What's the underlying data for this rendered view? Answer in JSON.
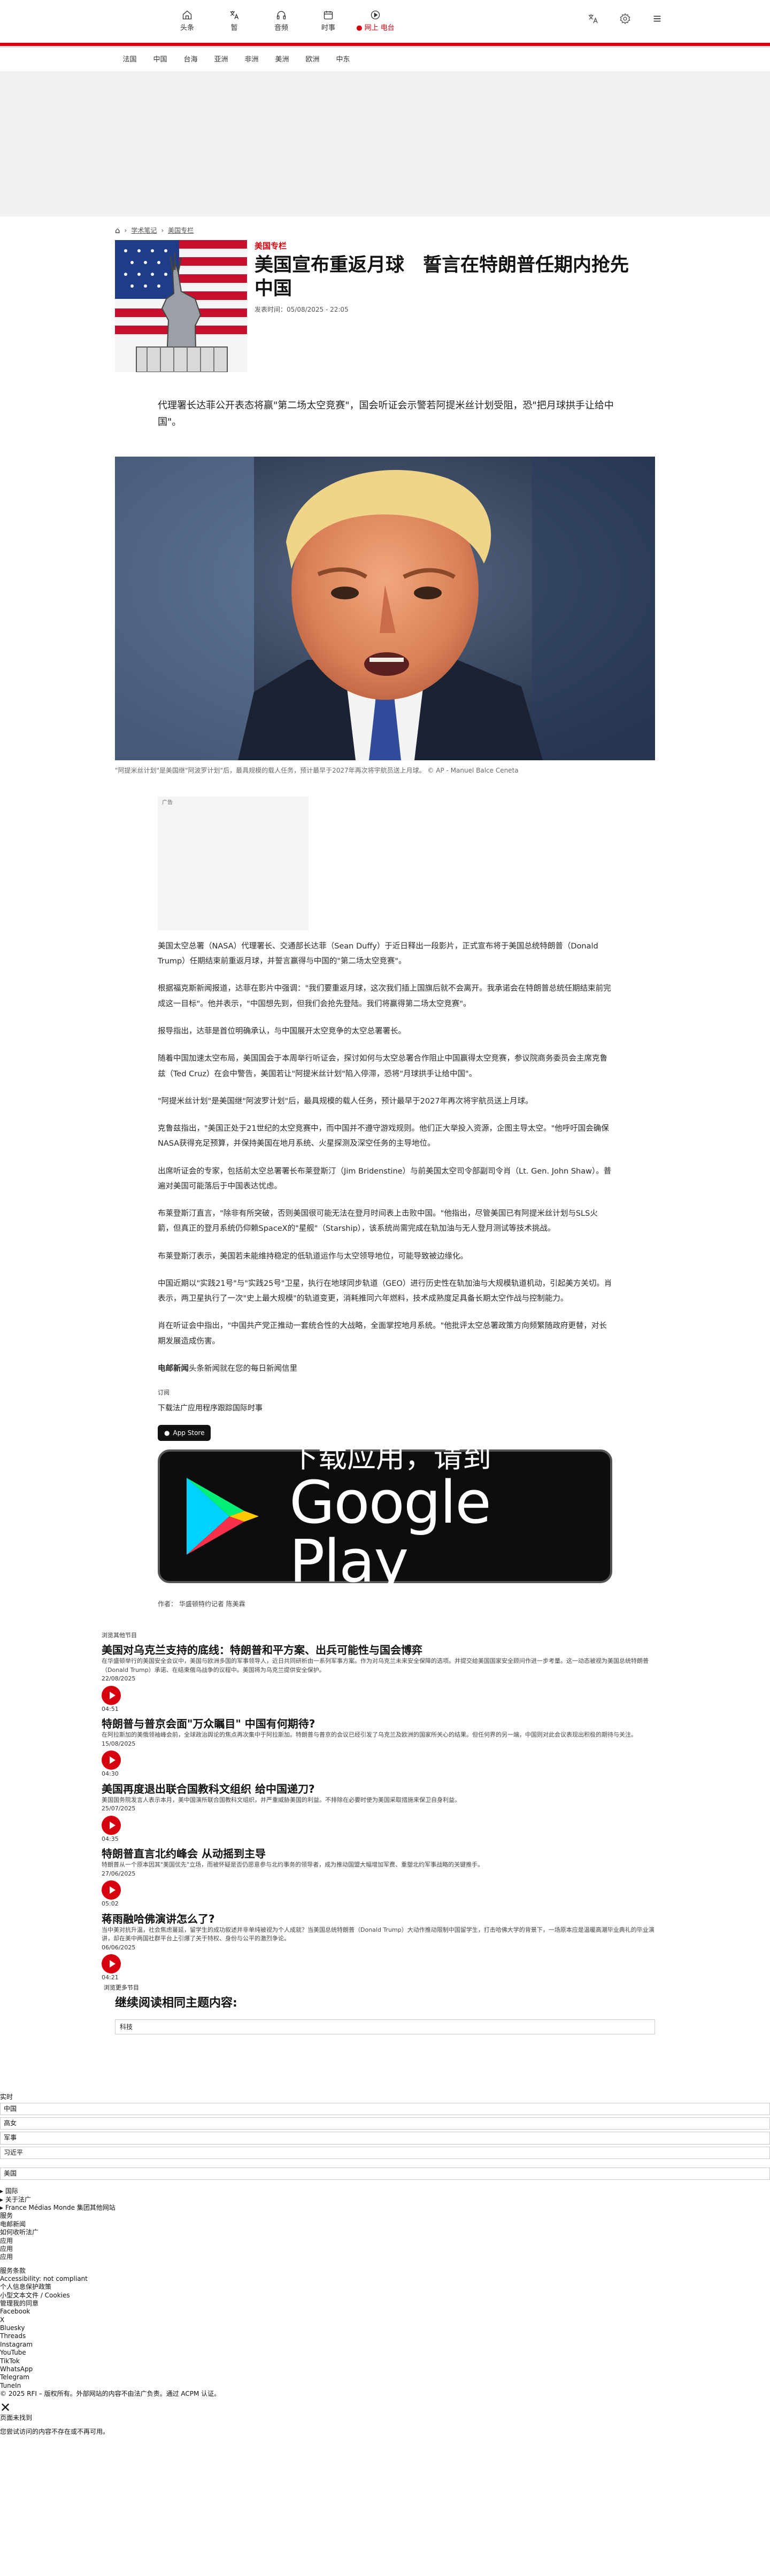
{
  "topnav": {
    "items": [
      {
        "label": "头条",
        "icon": "home-icon"
      },
      {
        "label": "暂",
        "icon": "translate-icon"
      },
      {
        "label": "音频",
        "icon": "headphones-icon"
      },
      {
        "label": "时事",
        "icon": "calendar-icon"
      },
      {
        "label": "网上 电台",
        "icon": "live-radio-icon"
      }
    ],
    "tools": [
      "translate-icon",
      "settings-icon",
      "menu-icon"
    ]
  },
  "subnav": [
    "法国",
    "中国",
    "台海",
    "亚洲",
    "非洲",
    "美洲",
    "欧洲",
    "中东"
  ],
  "breadcrumb": {
    "home": "home-icon",
    "items": [
      "学术笔记",
      "美国专栏"
    ]
  },
  "article": {
    "kicker": "美国专栏",
    "title": "美国宣布重返月球　誓言在特朗普任期内抢先中国",
    "published": "发表时间：05/08/2025 - 22:05",
    "lead": "代理署长达菲公开表态将赢\"第二场太空竞赛\"，国会听证会示警若阿提米丝计划受阻，恐\"把月球拱手让给中国\"。",
    "caption": "\"阿提米丝计划\"是美国继\"阿波罗计划\"后，最具规模的载人任务，预计最早于2027年再次将宇航员送上月球。 © AP - Manuel Balce Ceneta",
    "ad_label": "广告",
    "paragraphs": [
      "美国太空总署（NASA）代理署长、交通部长达菲（Sean Duffy）于近日释出一段影片，正式宣布将于美国总统特朗普（Donald Trump）任期结束前重返月球，并誓言赢得与中国的\"第二场太空竞赛\"。",
      "根据福克斯新闻报道，达菲在影片中强调：\"我们要重返月球，这次我们插上国旗后就不会离开。我承诺会在特朗普总统任期结束前完成这一目标\"。他并表示，\"中国想先到，但我们会抢先登陆。我们将赢得第二场太空竞赛\"。",
      "报导指出，达菲是首位明确承认，与中国展开太空竞争的太空总署署长。",
      "随着中国加速太空布局，美国国会于本周举行听证会，探讨如何与太空总署合作阻止中国赢得太空竞赛，参议院商务委员会主席克鲁兹（Ted Cruz）在会中警告，美国若让\"阿提米丝计划\"陷入停滞，恐将\"月球拱手让给中国\"。",
      "\"阿提米丝计划\"是美国继\"阿波罗计划\"后，最具规模的载人任务，预计最早于2027年再次将宇航员送上月球。",
      "克鲁兹指出，\"美国正处于21世纪的太空竞赛中，而中国并不遵守游戏规则。他们正大举投入资源，企图主导太空。\"他呼吁国会确保NASA获得充足预算，并保持美国在地月系统、火星探测及深空任务的主导地位。",
      "出席听证会的专家，包括前太空总署署长布莱登斯汀（Jim Bridenstine）与前美国太空司令部副司令肖（Lt. Gen. John Shaw）。普遍对美国可能落后于中国表达忧虑。",
      "布莱登斯汀直言，\"除非有所突破，否则美国很可能无法在登月时间表上击败中国。\"他指出，尽管美国已有阿提米丝计划与SLS火箭，但真正的登月系统仍仰赖SpaceX的\"星舰\"（Starship），该系统尚需完成在轨加油与无人登月测试等技术挑战。",
      "布莱登斯汀表示，美国若未能维持稳定的低轨道运作与太空领导地位，可能导致被边缘化。",
      "中国近期以\"实践21号\"与\"实践25号\"卫星，执行在地球同步轨道（GEO）进行历史性在轨加油与大规模轨道机动，引起美方关切。肖表示，两卫星执行了一次\"史上最大规模\"的轨道变更，消耗推同六年燃料，技术成熟度足具备长期太空作战与控制能力。",
      "肖在听证会中指出，\"中国共产党正推动一套统合性的大战略，全面掌控地月系统。\"他批评太空总署政策方向频繁随政府更替，对长期发展造成伤害。"
    ],
    "newsletter_lead": "电邮新闻",
    "newsletter_rest": "头条新闻就在您的每日新闻信里",
    "subscribe": "订阅",
    "download": "下载法广应用程序跟踪国际时事",
    "appstore": "App Store",
    "gplay_line1": "下载应用，请到",
    "gplay_line2": "Google Play",
    "author": "作者： 华盛顿特约记者 陈美霖"
  },
  "related": {
    "label": "浏览其他节目",
    "items": [
      {
        "title": "美国对乌克兰支持的底线：特朗普和平方案、出兵可能性与国会博弈",
        "desc": "在华盛顿举行的美国安全会议中，美国与欧洲多国的军事领导人，近日共同研析由一系列军事方案。作为对乌克兰未来安全保障的选项。并提交给美国国家安全顾问作进一步考量。这一动态被视为美国总统特朗普（Donald Trump）承诺、在结束俄乌战争的议程中。美国将为乌克兰提供安全保护。",
        "date": "22/08/2025",
        "dur": "04:51"
      },
      {
        "title": "特朗普与普京会面\"万众瞩目\" 中国有何期待?",
        "desc": "在阿拉斯加的美俄领袖峰会前，全球政治舆论的焦点再次集中于阿拉斯加。特朗普与普京的会议已经引发了乌克兰及欧洲的国家所关心的结果。但任何界的另一端，中国则对此会议表现出积极的期待与关注。",
        "date": "15/08/2025",
        "dur": "04:30"
      },
      {
        "title": "美国再度退出联合国教科文组织 给中国递刀?",
        "desc": "美国国务院发言人表示本月，美中国演所联合国教科文组织，并严重威胁美国的利益。不排除在必要时使为美国采取措施来保卫自身利益。",
        "date": "25/07/2025",
        "dur": "04:35"
      },
      {
        "title": "特朗普直言北约峰会 从动摇到主导",
        "desc": "特朗普从一个原本因其\"美国优先\"立场，而被怀疑是否仍愿意参与北约事务的领导者，成为推动国盟大幅增加军费、重塑北约军事战略的关键推手。",
        "date": "27/06/2025",
        "dur": "05:02"
      },
      {
        "title": "蒋雨融哈佛演讲怎么了?",
        "desc": "当中美对抗升温，社会焦虑蔓延，留学生的成功叙述并非单纯被视为个人成就？当美国总统特朗普（Donald Trump）大动作推动限制中国留学生，打击哈佛大学的背景下，一场原本应是温暖高潮毕业典礼的毕业演讲，却在美中两国社群平台上引爆了关于特权、身份与公平的激烈争论。",
        "date": "06/06/2025",
        "dur": "04:21"
      }
    ],
    "more": "浏览更多节目",
    "continue_title": "继续阅读相同主题内容:",
    "tag": "科技"
  },
  "footer": {
    "live": "实时",
    "live_items": [
      "中国",
      "高女",
      "军事",
      "习近平"
    ],
    "after_live": "美国",
    "links1": [
      "国际",
      "关于法广",
      "France Médias Monde 集团其他网站"
    ],
    "links2": [
      "服务",
      "电邮新闻",
      "如何收听法广",
      "应用",
      "应用",
      "应用"
    ],
    "links3": [
      "服务条款",
      "Accessibility: not compliant",
      "个人信息保护政策",
      "小型文本文件 / Cookies",
      "管理我的同意"
    ],
    "social": [
      "Facebook",
      "X",
      "Bluesky",
      "Threads",
      "Instagram",
      "YouTube",
      "TikTok",
      "WhatsApp",
      "Telegram",
      "TuneIn"
    ],
    "copyright": "© 2025 RFI – 版权所有。外部网站的内容不由法广负责。通过 ACPM 认证。",
    "close": "✕",
    "notice_title": "页面未找到",
    "notice_text": "您尝试访问的内容不存在或不再可用。"
  }
}
